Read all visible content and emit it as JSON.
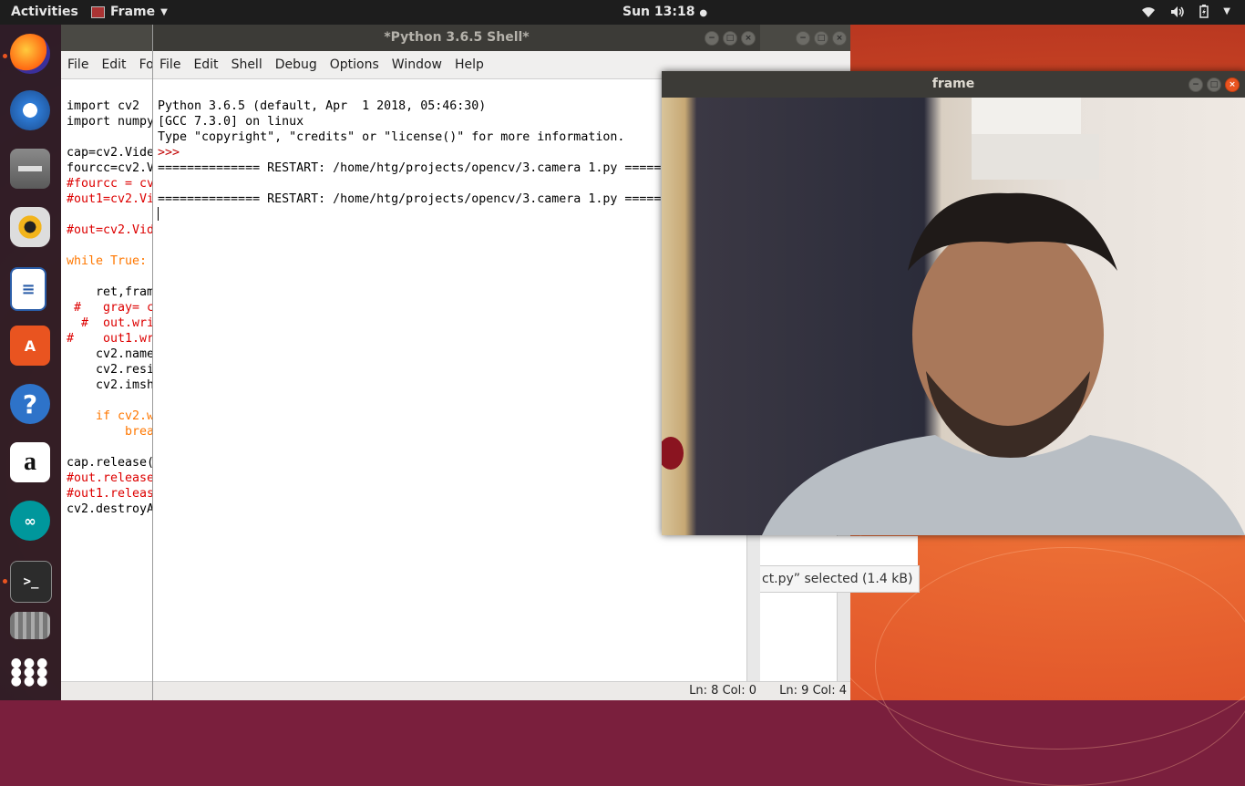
{
  "top_panel": {
    "activities": "Activities",
    "app_menu": "Frame",
    "clock": "Sun 13:18",
    "tray_icons": [
      "wifi-icon",
      "volume-icon",
      "battery-icon",
      "chevron-down-icon"
    ]
  },
  "dock": {
    "items": [
      "Firefox",
      "Thunderbird",
      "Files",
      "Rhythmbox",
      "LibreOffice Writer",
      "Ubuntu Software",
      "Help",
      "Amazon",
      "Arduino",
      "Terminal",
      "Videos",
      "Show Applications"
    ]
  },
  "editor": {
    "menu": [
      "File",
      "Edit",
      "Fo"
    ],
    "code_lines": [
      "import cv2",
      "import numpy",
      "",
      "cap=cv2.Vide",
      "fourcc=cv2.V",
      "#fourcc = cv",
      "#out1=cv2.Vi",
      "",
      "#out=cv2.Vid",
      "",
      "while True:",
      "",
      "    ret,fram",
      " #   gray= c",
      "  #  out.wri",
      "#    out1.wr",
      "    cv2.name",
      "    cv2.resi",
      "    cv2.imsh",
      "",
      "    if cv2.w",
      "        brea",
      "",
      "cap.release(",
      "#out.release",
      "#out1.releas",
      "cv2.destroyA"
    ],
    "status": "Ln: 9  Col: 4"
  },
  "shell": {
    "title": "*Python 3.6.5 Shell*",
    "menu": [
      "File",
      "Edit",
      "Shell",
      "Debug",
      "Options",
      "Window",
      "Help"
    ],
    "lines": [
      "Python 3.6.5 (default, Apr  1 2018, 05:46:30)",
      "[GCC 7.3.0] on linux",
      "Type \"copyright\", \"credits\" or \"license()\" for more information.",
      ">>> ",
      "============== RESTART: /home/htg/projects/opencv/3.camera 1.py =====",
      "",
      "============== RESTART: /home/htg/projects/opencv/3.camera 1.py ====="
    ],
    "status": "Ln: 8  Col: 0"
  },
  "file_status": {
    "text": "ct.py” selected  (1.4 kB)"
  },
  "frame": {
    "title": "frame"
  }
}
